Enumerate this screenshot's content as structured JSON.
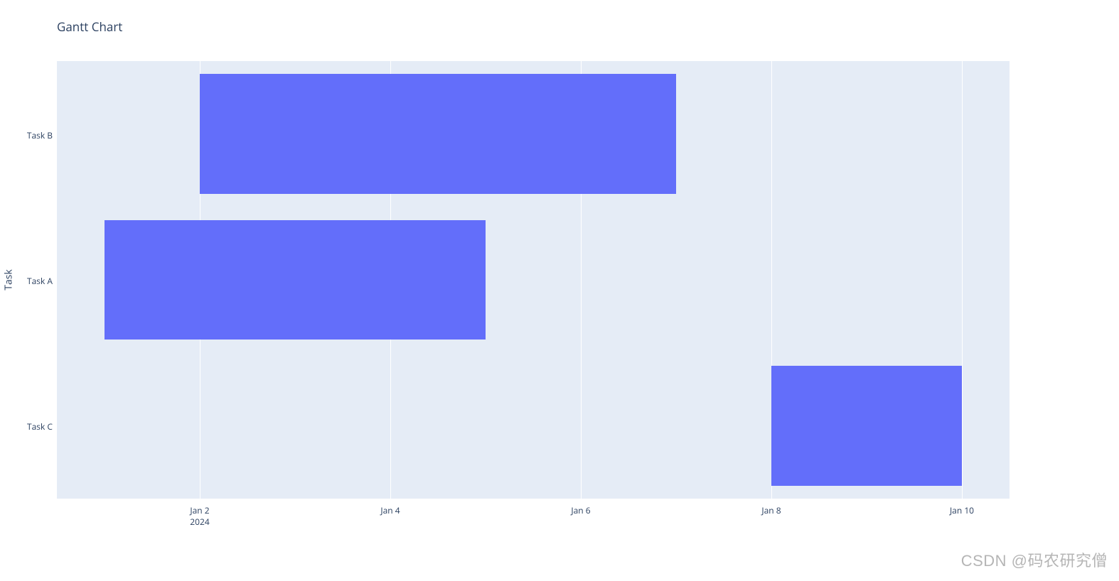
{
  "chart_data": {
    "type": "bar",
    "orientation": "horizontal-gantt",
    "title": "Gantt Chart",
    "ylabel": "Task",
    "xlabel": "",
    "categories": [
      "Task B",
      "Task A",
      "Task C"
    ],
    "series": [
      {
        "name": "Task B",
        "start": "Jan 2",
        "end": "Jan 7",
        "start_idx": 1,
        "end_idx": 6
      },
      {
        "name": "Task A",
        "start": "Jan 1",
        "end": "Jan 5",
        "start_idx": 0,
        "end_idx": 4
      },
      {
        "name": "Task C",
        "start": "Jan 8",
        "end": "Jan 10",
        "start_idx": 7,
        "end_idx": 9
      }
    ],
    "x_ticks": [
      "Jan 2",
      "Jan 4",
      "Jan 6",
      "Jan 8",
      "Jan 10"
    ],
    "x_tick_idx": [
      1,
      3,
      5,
      7,
      9
    ],
    "x_year": "2024",
    "x_domain": [
      -0.5,
      9.5
    ],
    "bar_color": "#636efa",
    "plot_bg": "#e5ecf6"
  },
  "watermark": "CSDN @码农研究僧"
}
